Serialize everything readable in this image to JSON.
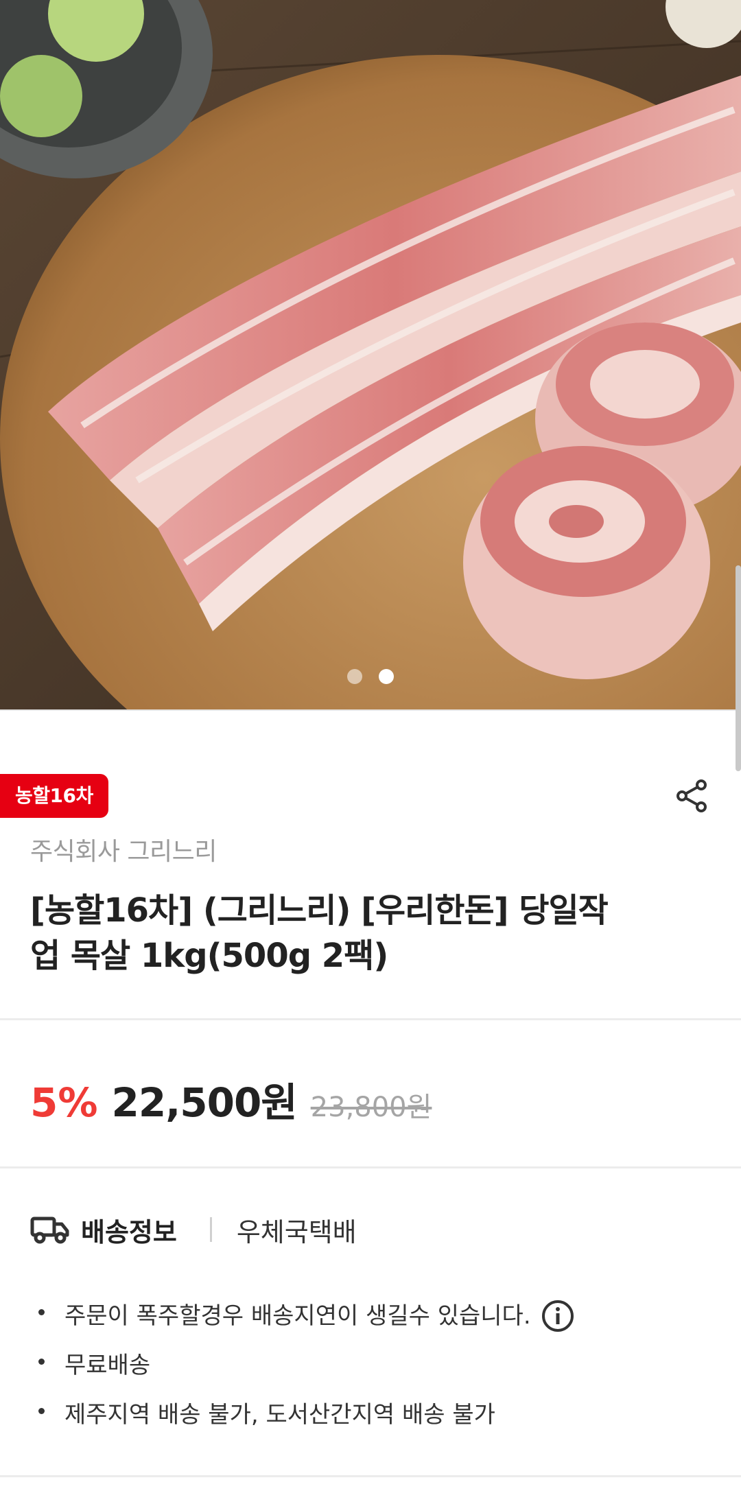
{
  "hero": {
    "image_icon": "pork-belly-photo",
    "slide_count": 2,
    "active_slide": 2
  },
  "product": {
    "badge": "농할16차",
    "seller": "주식회사 그리느리",
    "title": "[농할16차] (그리느리) [우리한돈] 당일작업 목살 1kg(500g 2팩)",
    "share_icon": "share-icon"
  },
  "price": {
    "discount": "5%",
    "sale_price": "22,500원",
    "original_price": "23,800원",
    "discount_color": "#ef3b36"
  },
  "shipping": {
    "icon": "truck-icon",
    "label": "배송정보",
    "method": "우체국택배",
    "notes": [
      "주문이 폭주할경우 배송지연이 생길수 있습니다.",
      "무료배송",
      "제주지역 배송 불가, 도서산간지역 배송 불가"
    ]
  },
  "colors": {
    "badge": "#e60012",
    "text": "#222222",
    "muted": "#9a9a9a"
  }
}
